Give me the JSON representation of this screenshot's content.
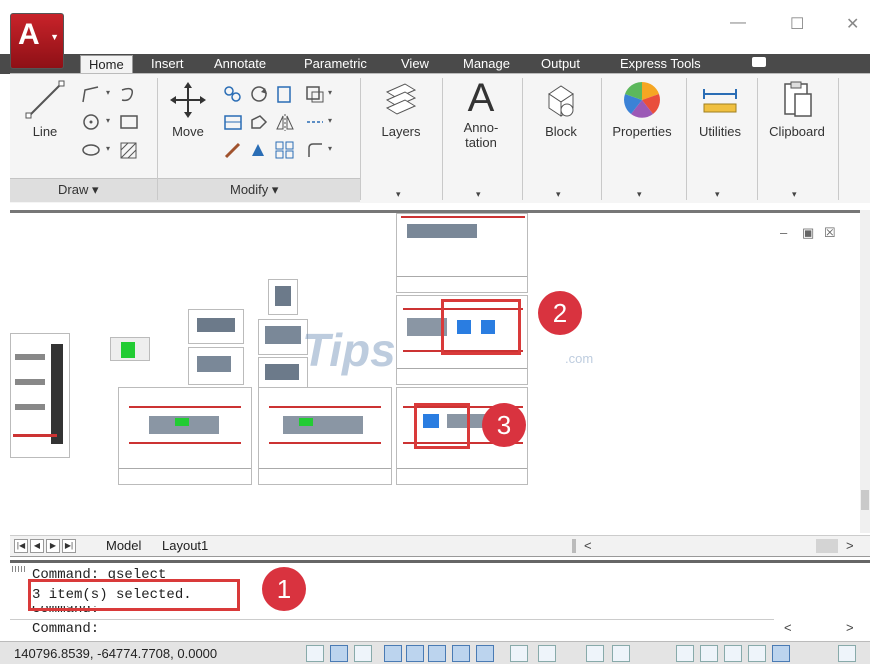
{
  "ribbon": {
    "tabs": [
      "Home",
      "Insert",
      "Annotate",
      "Parametric",
      "View",
      "Manage",
      "Output",
      "Express Tools"
    ],
    "active_tab": "Home",
    "draw": {
      "line_label": "Line",
      "panel_label": "Draw ▾"
    },
    "modify": {
      "move_label": "Move",
      "panel_label": "Modify ▾"
    },
    "layers_label": "Layers",
    "annotation_label_1": "Anno-",
    "annotation_label_2": "tation",
    "block_label": "Block",
    "properties_label": "Properties",
    "utilities_label": "Utilities",
    "clipboard_label": "Clipboard",
    "dropdown_arrow": "▾"
  },
  "window": {
    "minimize_glyph": "—",
    "maximize_glyph": "☐",
    "close_glyph": "✕",
    "app_logo": "A"
  },
  "viewport": {
    "controls": [
      "–",
      "▣",
      "☒"
    ],
    "watermark": "TipsMake",
    "watermark_suffix": ".com"
  },
  "badges": [
    "2",
    "3",
    "1"
  ],
  "layout_tabs": [
    "Model",
    "Layout1"
  ],
  "command": {
    "line1": "Command: qselect",
    "line2": "3 item(s) selected.",
    "line3": "Command:",
    "prompt": "Command:"
  },
  "status": {
    "coordinates": "140796.8539, -64774.7708, 0.0000"
  },
  "colors": {
    "accent_red": "#d9333f",
    "ribbon_tabbar": "#4a4a4a",
    "selection_blue": "#2a7de1"
  }
}
